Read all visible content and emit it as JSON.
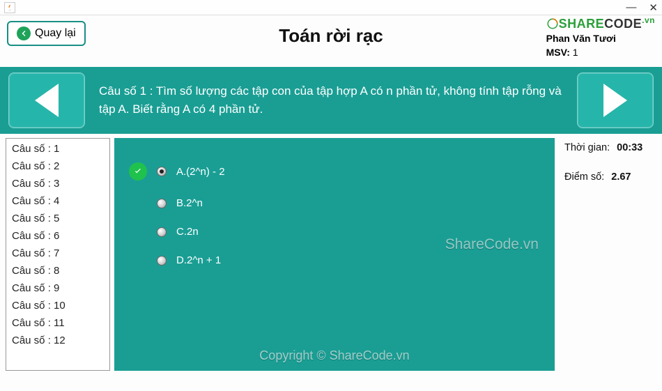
{
  "window": {
    "minimize": "—",
    "close": "✕"
  },
  "brand": {
    "share": "SHARE",
    "code": "CODE",
    "vn": ".vn"
  },
  "header": {
    "back_label": "Quay lại",
    "title": "Toán rời rạc",
    "student_name": "Phan Văn Tươi",
    "msv_label": "MSV:",
    "msv_value": "1"
  },
  "question": {
    "prompt": "Câu số 1 : Tìm số lượng các tập con của tập hợp A có n phần tử, không tính tập rỗng và tập A. Biết rằng A có 4 phần tử."
  },
  "question_list": [
    "Câu số : 1",
    "Câu số : 2",
    "Câu số : 3",
    "Câu số : 4",
    "Câu số : 5",
    "Câu số : 6",
    "Câu số : 7",
    "Câu số : 8",
    "Câu số : 9",
    "Câu số : 10",
    "Câu số : 11",
    "Câu số : 12"
  ],
  "answers": [
    {
      "label": "A.(2^n) - 2",
      "selected": true,
      "correct": true
    },
    {
      "label": "B.2^n",
      "selected": false,
      "correct": false
    },
    {
      "label": "C.2n",
      "selected": false,
      "correct": false
    },
    {
      "label": "D.2^n + 1",
      "selected": false,
      "correct": false
    }
  ],
  "side": {
    "time_label": "Thời gian:",
    "time_value": "00:33",
    "score_label": "Điểm số:",
    "score_value": "2.67"
  },
  "watermark": {
    "w1": "ShareCode.vn",
    "w2": "Copyright © ShareCode.vn"
  }
}
